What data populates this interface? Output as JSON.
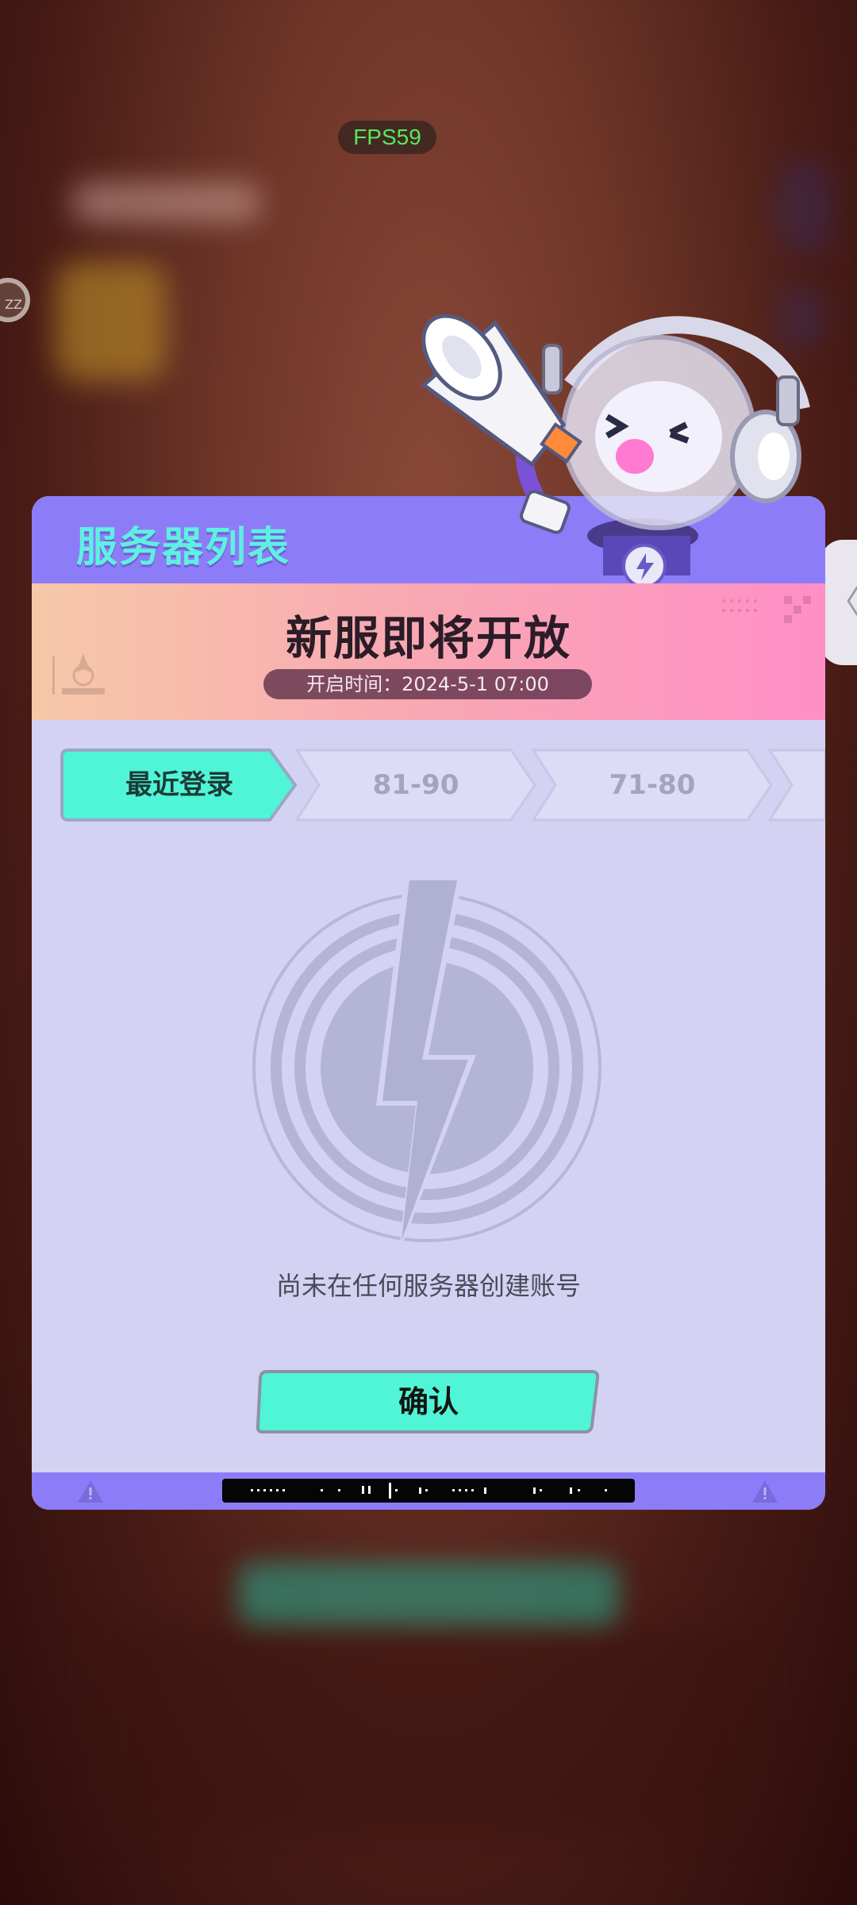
{
  "overlay": {
    "fps": "FPS59",
    "side_button": "ZZ",
    "right_tab_glyph": "〈"
  },
  "dialog": {
    "title": "服务器列表",
    "banner": {
      "title": "新服即将开放",
      "open_time": "开启时间：2024-5-1 07:00"
    },
    "tabs": [
      {
        "label": "最近登录",
        "active": true
      },
      {
        "label": "81-90",
        "active": false
      },
      {
        "label": "71-80",
        "active": false
      },
      {
        "label": "",
        "active": false
      }
    ],
    "empty_message": "尚未在任何服务器创建账号",
    "confirm_label": "确认"
  },
  "colors": {
    "accent_mint": "#4ff5d6",
    "header_purple": "#8d7cf8",
    "panel_lavender": "#d4d2f2",
    "banner_pink": "#ff8fc6",
    "fps_green": "#56e85a"
  },
  "icons": [
    "lightning-bolt-icon",
    "warning-triangle-icon",
    "chevron-left-icon",
    "megaphone-icon"
  ]
}
